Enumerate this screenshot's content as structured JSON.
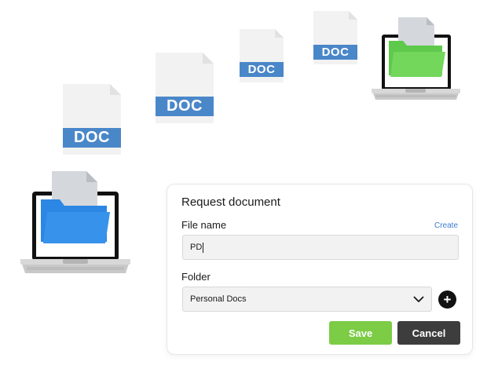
{
  "files": [
    {
      "label": "DOC"
    },
    {
      "label": "DOC"
    },
    {
      "label": "DOC"
    },
    {
      "label": "DOC"
    }
  ],
  "colors": {
    "doc_band": "#4a87c9",
    "doc_page": "#f2f2f2",
    "folder_blue": "#2d8ae5",
    "folder_green": "#72d75b",
    "save": "#7ccc46",
    "cancel": "#3d3d3d",
    "link": "#3a7bd5"
  },
  "dialog": {
    "title": "Request document",
    "file_name_label": "File name",
    "create_link": "Create",
    "file_name_value": "PD",
    "folder_label": "Folder",
    "folder_selected": "Personal Docs",
    "add_icon": "plus-icon",
    "save_label": "Save",
    "cancel_label": "Cancel"
  }
}
